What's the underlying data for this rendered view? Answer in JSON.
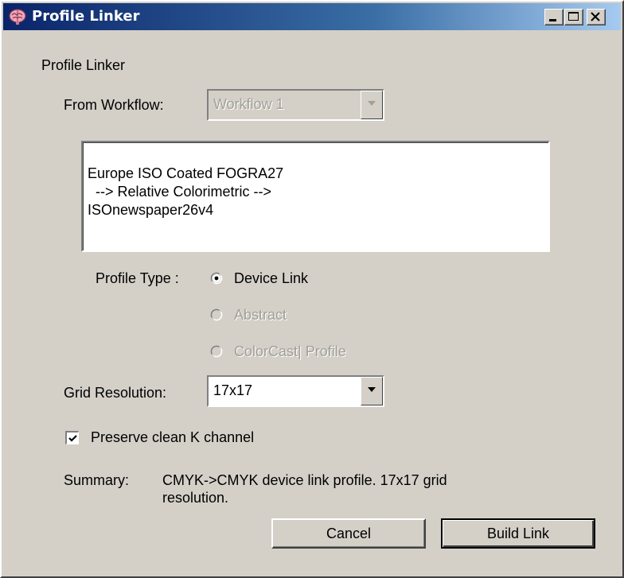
{
  "window": {
    "title": "Profile Linker"
  },
  "dialog": {
    "heading": "Profile Linker",
    "from_workflow_label": "From Workflow:",
    "from_workflow_value": "Workflow 1",
    "link_description": {
      "line1": "Europe ISO Coated FOGRA27",
      "line2": "  --> Relative Colorimetric -->",
      "line3": "ISOnewspaper26v4"
    },
    "profile_type_label": "Profile Type :",
    "profile_types": [
      {
        "label": "Device Link",
        "selected": true,
        "enabled": true
      },
      {
        "label": "Abstract",
        "selected": false,
        "enabled": false
      },
      {
        "label": "ColorCast| Profile",
        "selected": false,
        "enabled": false
      }
    ],
    "grid_resolution_label": "Grid Resolution:",
    "grid_resolution_value": "17x17",
    "preserve_k_label": "Preserve clean K channel",
    "preserve_k_checked": true,
    "summary_label": "Summary:",
    "summary_line1": "CMYK->CMYK device link profile. 17x17 grid",
    "summary_line2": "resolution.",
    "cancel_label": "Cancel",
    "build_label": "Build Link"
  },
  "icons": {
    "app": "brain-icon",
    "minimize": "minimize-icon",
    "maximize": "maximize-icon",
    "close": "close-icon",
    "dropdown": "chevron-down-icon"
  },
  "colors": {
    "title_gradient_start": "#0a246a",
    "title_gradient_end": "#a6caf0",
    "face": "#d4d0c8",
    "disabled_text": "#a19f97"
  }
}
